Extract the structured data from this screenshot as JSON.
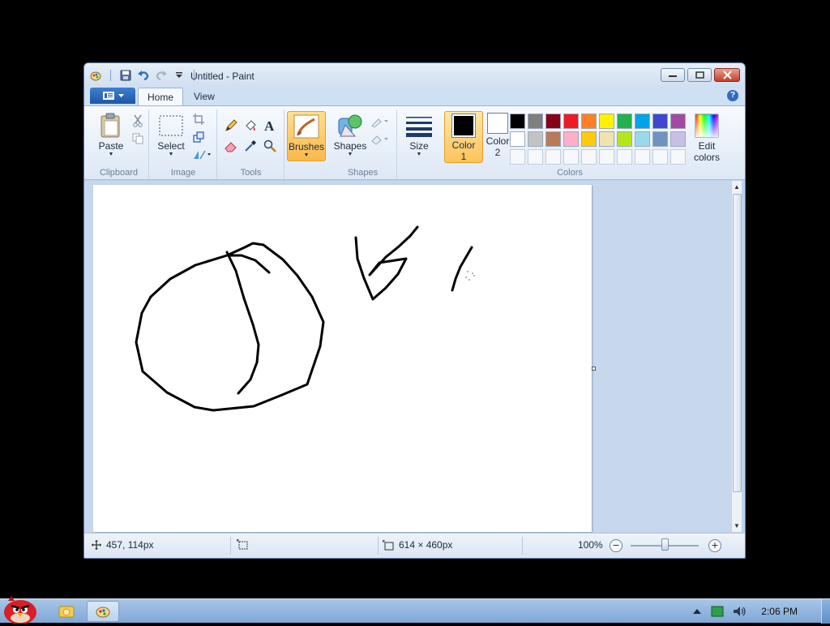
{
  "window": {
    "title": "Untitled - Paint",
    "qat_icons": [
      "paint-app-icon",
      "save-icon",
      "undo-icon",
      "redo-icon",
      "customize-dropdown-icon"
    ]
  },
  "tabs": [
    {
      "label": "Home",
      "active": true
    },
    {
      "label": "View",
      "active": false
    }
  ],
  "ribbon": {
    "clipboard": {
      "group_label": "Clipboard",
      "paste_label": "Paste"
    },
    "image": {
      "group_label": "Image",
      "select_label": "Select"
    },
    "tools": {
      "group_label": "Tools"
    },
    "brushes": {
      "label": "Brushes"
    },
    "shapes": {
      "group_label": "Shapes",
      "shapes_label": "Shapes"
    },
    "size": {
      "label": "Size"
    },
    "colors": {
      "group_label": "Colors",
      "color1_label": "Color",
      "color1_num": "1",
      "color2_label": "Color",
      "color2_num": "2",
      "edit_label_1": "Edit",
      "edit_label_2": "colors",
      "color1_value": "#000000",
      "color2_value": "#ffffff",
      "palette_row1": [
        "#000000",
        "#7f7f7f",
        "#880015",
        "#ed1c24",
        "#ff7f27",
        "#fff200",
        "#22b14c",
        "#00a2e8",
        "#3f48cc",
        "#a349a4"
      ],
      "palette_row2": [
        "#ffffff",
        "#c3c3c3",
        "#b97a57",
        "#ffaec9",
        "#ffc90e",
        "#efe4b0",
        "#b5e61d",
        "#99d9ea",
        "#7092be",
        "#c8bfe7"
      ],
      "palette_row3": [
        "",
        "",
        "",
        "",
        "",
        "",
        "",
        "",
        "",
        ""
      ]
    }
  },
  "status": {
    "cursor_pos": "457, 114px",
    "canvas_size": "614 × 460px",
    "zoom": "100%",
    "zoom_minus": "−",
    "zoom_plus": "+"
  },
  "taskbar": {
    "clock": "2:06 PM"
  }
}
